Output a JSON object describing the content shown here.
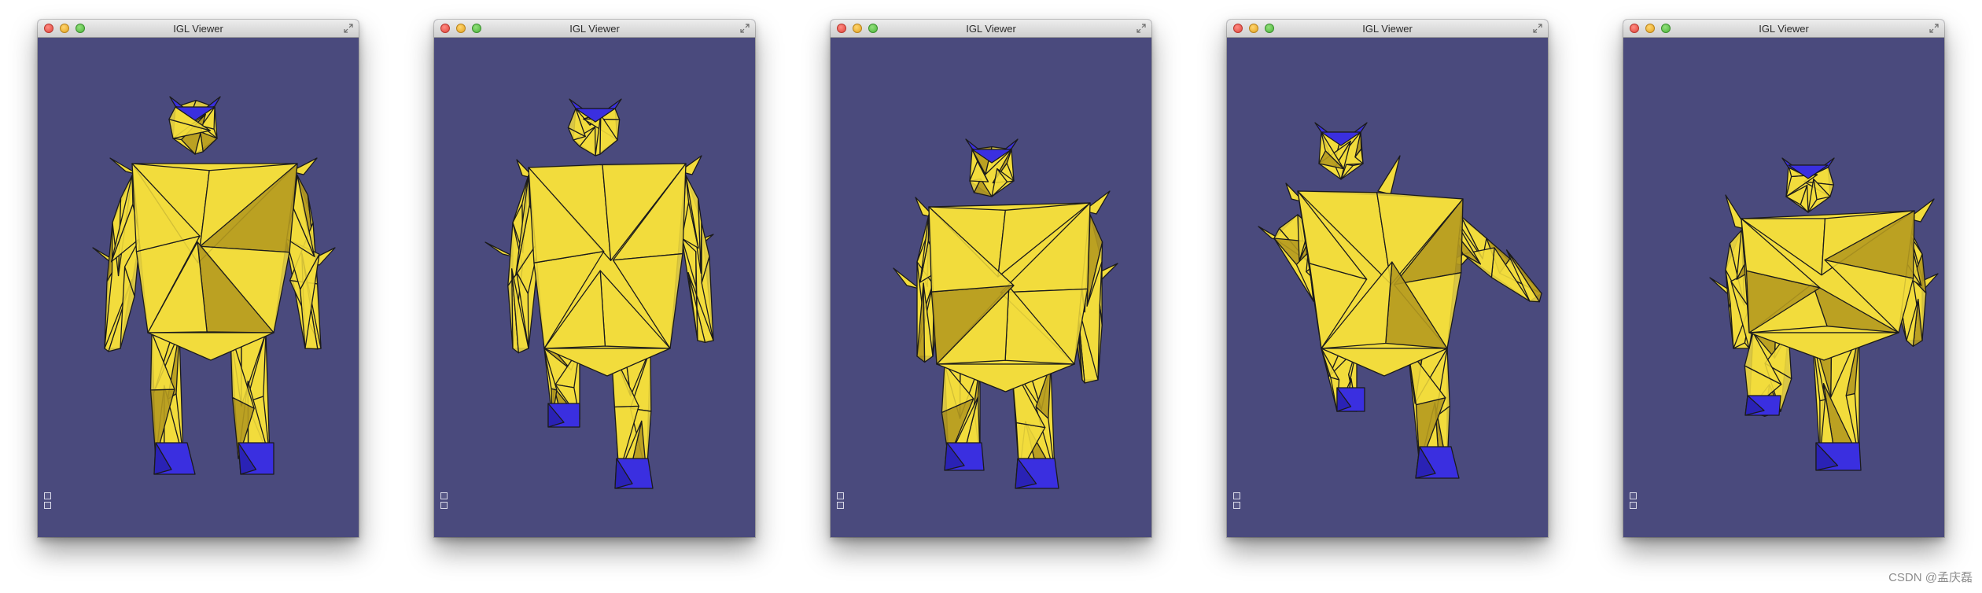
{
  "windows": [
    {
      "title": "IGL Viewer",
      "pose": "standing",
      "model_icon": "mesh-robot-icon"
    },
    {
      "title": "IGL Viewer",
      "pose": "walking-step",
      "model_icon": "mesh-robot-icon"
    },
    {
      "title": "IGL Viewer",
      "pose": "crouched-walk",
      "model_icon": "mesh-robot-icon"
    },
    {
      "title": "IGL Viewer",
      "pose": "twisting-kick",
      "model_icon": "mesh-robot-icon"
    },
    {
      "title": "IGL Viewer",
      "pose": "low-crouch",
      "model_icon": "mesh-robot-icon"
    }
  ],
  "colors": {
    "viewport_bg": "#4a4a7d",
    "mesh_yellow": "#f2dc3c",
    "mesh_shadow": "#b59a1f",
    "handle_blue": "#3a2fe0",
    "edge": "#1b1b1b"
  },
  "watermark": "CSDN @孟庆磊"
}
